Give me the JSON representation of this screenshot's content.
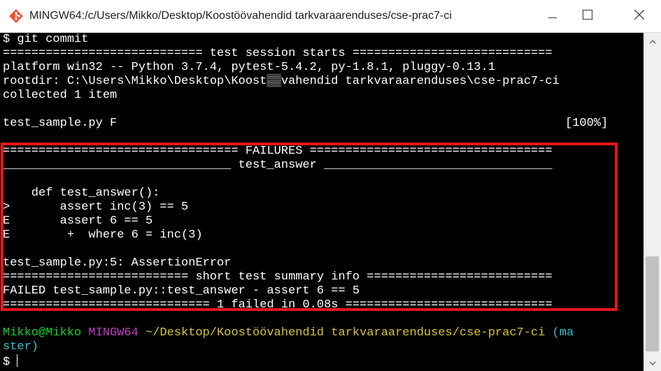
{
  "window": {
    "title": "MINGW64:/c/Users/Mikko/Desktop/Koostöövahendid tarkvaraarenduses/cse-prac7-ci",
    "icon": "git-bash-icon",
    "controls": {
      "minimize": "minimize-icon",
      "maximize": "maximize-icon",
      "close": "close-icon"
    }
  },
  "colors": {
    "terminal_bg": "#000000",
    "text": "#ffffff",
    "user_host": "#13d12d",
    "mingw": "#c43dc5",
    "path": "#d8c531",
    "branch": "#2dc5c9",
    "highlight_border": "#e8151b"
  },
  "terminal": {
    "lines": [
      "$ git commit",
      "============================ test session starts ============================",
      "platform win32 -- Python 3.7.4, pytest-5.4.2, py-1.8.1, pluggy-0.13.1",
      "rootdir: C:\\Users\\Mikko\\Desktop\\Koost▒▒vahendid tarkvaraarenduses\\cse-prac7-ci",
      "collected 1 item",
      "",
      "test_sample.py F",
      "",
      "================================= FAILURES ==================================",
      "________________________________ test_answer ________________________________",
      "",
      "    def test_answer():",
      ">       assert inc(3) == 5",
      "E       assert 6 == 5",
      "E        +  where 6 = inc(3)",
      "",
      "test_sample.py:5: AssertionError",
      "========================== short test summary info ==========================",
      "FAILED test_sample.py::test_answer - assert 6 == 5",
      "============================= 1 failed in 0.08s =============================",
      ""
    ],
    "progress_label": "[100%]",
    "prompt": {
      "user_host": "Mikko@Mikko",
      "mingw": "MINGW64",
      "path": "~/Desktop/Koostöövahendid tarkvaraarenduses/cse-prac7-ci",
      "branch_part1": "(ma",
      "branch_part2": "ster)",
      "symbol": "$"
    }
  }
}
